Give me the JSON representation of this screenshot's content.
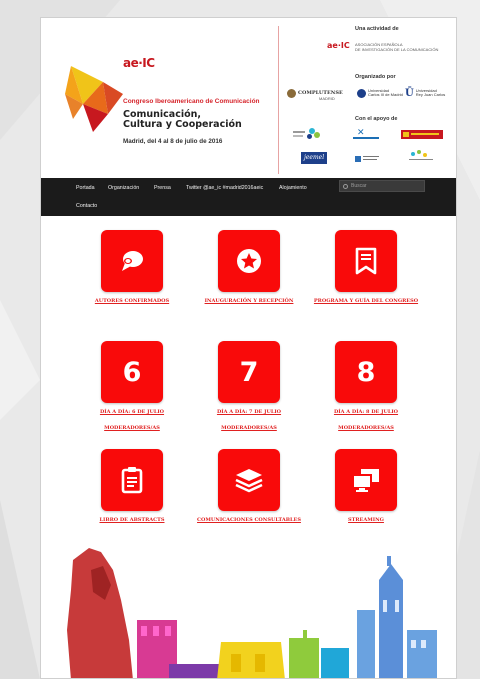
{
  "colors": {
    "accent": "#f90a0a",
    "nav_bg": "#1b1b1b",
    "brand_red": "#c7181f"
  },
  "brand": {
    "logo_text": "ae·IC"
  },
  "conference": {
    "name": "Congreso Iberoamericano de Comunicación",
    "theme_line1": "Comunicación,",
    "theme_line2": "Cultura y Cooperación",
    "dates": "Madrid, del 4 al 8 de julio de 2016"
  },
  "right_col": {
    "activity_title": "Una actividad de",
    "aeic_short": "ae·IC",
    "aeic_full_1": "ASOCIACIÓN ESPAÑOLA",
    "aeic_full_2": "DE INVESTIGACIÓN DE LA COMUNICACIÓN",
    "organized_title": "Organizado por",
    "org1": "COMPLUTENSE",
    "org1_sub": "MADRID",
    "org2": "Universidad",
    "org2_sub": "Carlos III de Madrid",
    "org3": "Universidad",
    "org3_sub": "Rey Juan Carlos",
    "support_title": "Con el apoyo de"
  },
  "nav": {
    "items": [
      "Portada",
      "Organización",
      "Prensa",
      "Twitter @ae_ic #madrid2016aeic",
      "Alojamiento"
    ],
    "items_row2": [
      "Contacto"
    ],
    "search_placeholder": "Buscar"
  },
  "tiles": [
    {
      "icon": "chat-bubble-icon",
      "label": "AUTORES CONFIRMADOS"
    },
    {
      "icon": "star-badge-icon",
      "label": "INAUGURACIÓN Y RECEPCIÓN"
    },
    {
      "icon": "bookmark-note-icon",
      "label": "PROGRAMA Y GUÍA DEL CONGRESO"
    },
    {
      "number": "6",
      "label": "DÍA A DÍA: 6 DE JULIO",
      "sub": "MODERADORES/AS"
    },
    {
      "number": "7",
      "label": "DÍA A DÍA: 7 DE JULIO",
      "sub": "MODERADORES/AS"
    },
    {
      "number": "8",
      "label": "DÍA A DÍA: 8 DE JULIO",
      "sub": "MODERADORES/AS"
    },
    {
      "icon": "clipboard-doc-icon",
      "label": "LIBRO DE ABSTRACTS"
    },
    {
      "icon": "layers-stack-icon",
      "label": "COMUNICACIONES CONSULTABLES"
    },
    {
      "icon": "monitors-icon",
      "label": "STREAMING"
    }
  ]
}
